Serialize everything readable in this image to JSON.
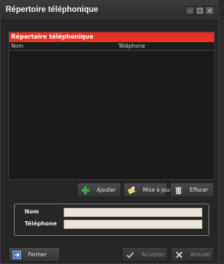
{
  "window": {
    "title": "Répertoire téléphonique",
    "buttons": {
      "minimize": "–",
      "maximize": "□",
      "close": "×"
    }
  },
  "list": {
    "title": "Répertoire téléphonique",
    "columns": [
      "Nom",
      "Téléphone"
    ],
    "rows": []
  },
  "actions": {
    "add": "Ajouter",
    "update": "Mise à jour",
    "delete": "Effacer"
  },
  "form": {
    "name_label": "Nom",
    "name_value": "",
    "phone_label": "Téléphone",
    "phone_value": ""
  },
  "footer": {
    "close": "Fermer",
    "accept": "Accepter",
    "cancel": "Annuler"
  },
  "colors": {
    "accent": "#e63228",
    "field_bg": "#ece6da",
    "add_icon": "#3aa84a",
    "cancel_icon": "#cfcfcf"
  }
}
